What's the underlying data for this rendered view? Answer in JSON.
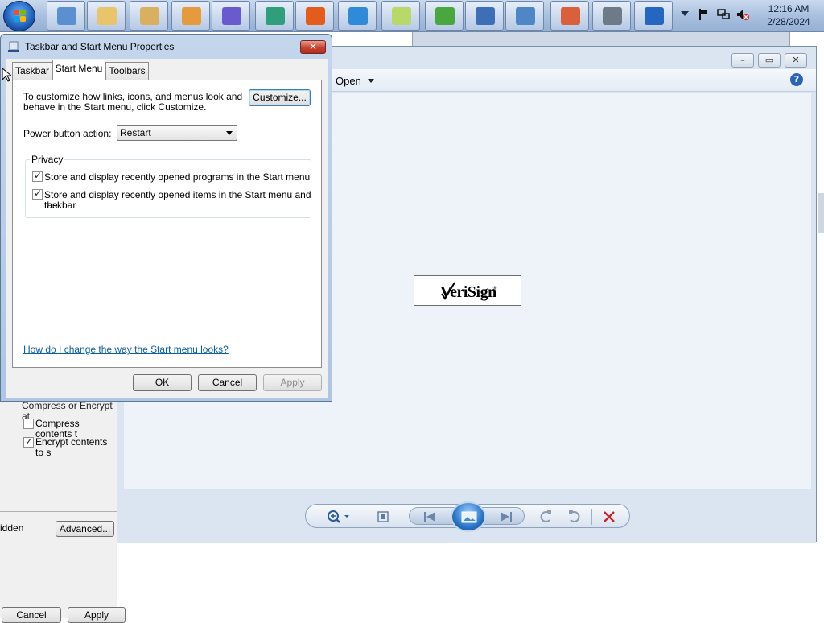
{
  "taskbar": {
    "items": [
      {
        "name": "control-panel-icon",
        "color": "#5a8fd0"
      },
      {
        "name": "folder-icon",
        "color": "#e8c56a"
      },
      {
        "name": "calculator-icon",
        "color": "#d8b060"
      },
      {
        "name": "media-player-icon",
        "color": "#e59a3c"
      },
      {
        "name": "visual-studio-icon",
        "color": "#6a5acd"
      },
      {
        "name": "app-green-icon",
        "color": "#2f9e7a"
      },
      {
        "name": "firefox-icon",
        "color": "#e55b1c"
      },
      {
        "name": "internet-explorer-icon",
        "color": "#2f8bd8"
      },
      {
        "name": "sticky-notes-icon",
        "color": "#b8d86a"
      },
      {
        "name": "windows-orb-icon",
        "color": "#4aa63f"
      },
      {
        "name": "wordpad-icon",
        "color": "#3c6fb6"
      },
      {
        "name": "photo-viewer-icon",
        "color": "#4e86c6"
      },
      {
        "name": "paint-icon",
        "color": "#d9603a"
      },
      {
        "name": "server-icon",
        "color": "#6e7a88"
      },
      {
        "name": "help-icon",
        "color": "#2466c0"
      }
    ],
    "clock": {
      "time": "12:16 AM",
      "date": "2/28/2024"
    }
  },
  "dialog": {
    "title": "Taskbar and Start Menu Properties",
    "close_label": "✕",
    "tabs": [
      "Taskbar",
      "Start Menu",
      "Toolbars"
    ],
    "active_tab": "Start Menu",
    "intro_line1": "To customize how links, icons, and menus look and",
    "intro_line2": "behave in the Start menu, click Customize.",
    "customize_label": "Customize...",
    "power_label": "Power button action:",
    "power_value": "Restart",
    "privacy_label": "Privacy",
    "privacy_programs": "Store and display recently opened programs in the Start menu",
    "privacy_items_line1": "Store and display recently opened items in the Start menu and the",
    "privacy_items_line2": "taskbar",
    "help_link": "How do I change the way the Start menu looks?",
    "ok_label": "OK",
    "cancel_label": "Cancel",
    "apply_label": "Apply"
  },
  "photo_viewer": {
    "open_label": "Open",
    "help_label": "?",
    "logo_text": "VeriSign",
    "trademark": "®"
  },
  "left_panel": {
    "compress_partial": "Compress or Encrypt at",
    "compress_label": "Compress contents t",
    "encrypt_label": "Encrypt contents to s",
    "hidden_partial": "idden",
    "advanced_label": "Advanced...",
    "cancel_label": "Cancel",
    "apply_label": "Apply"
  },
  "accent": {
    "title_bar": "#c4d6ec",
    "link": "#0b5fa4",
    "close": "#c7412f"
  }
}
